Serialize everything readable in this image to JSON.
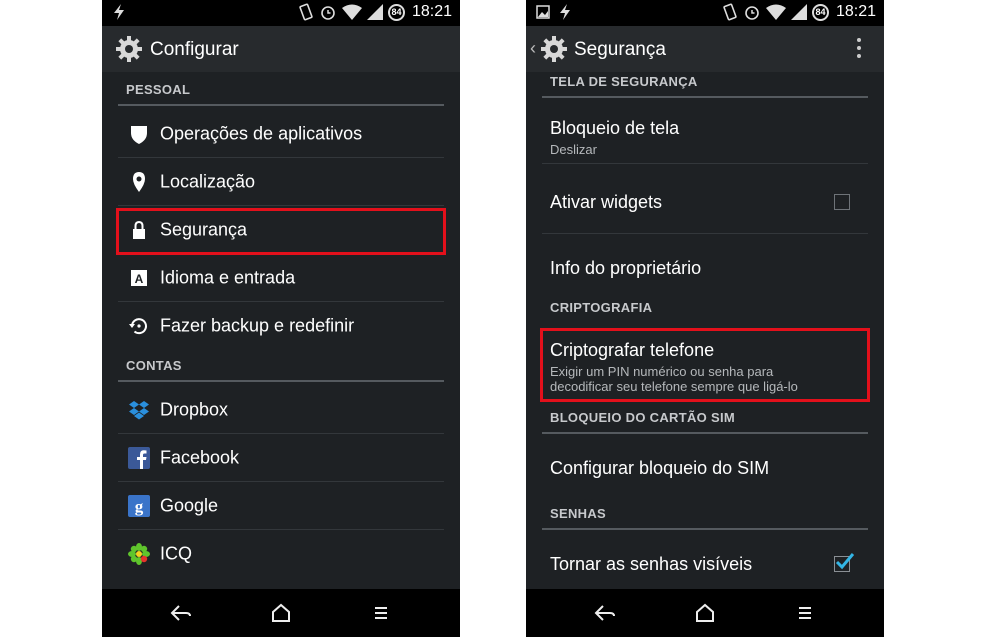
{
  "status": {
    "time": "18:21",
    "battery": "84"
  },
  "left": {
    "title": "Configurar",
    "sections": [
      {
        "header": "PESSOAL"
      },
      {
        "header": "CONTAS"
      }
    ],
    "items": [
      {
        "label": "Operações de aplicativos",
        "icon": "shield-icon"
      },
      {
        "label": "Localização",
        "icon": "location-pin-icon"
      },
      {
        "label": "Segurança",
        "icon": "lock-icon",
        "highlighted": true
      },
      {
        "label": "Idioma e entrada",
        "icon": "keyboard-a-icon"
      },
      {
        "label": "Fazer backup e redefinir",
        "icon": "backup-restore-icon"
      }
    ],
    "accounts": [
      {
        "label": "Dropbox",
        "icon": "dropbox-icon"
      },
      {
        "label": "Facebook",
        "icon": "facebook-icon"
      },
      {
        "label": "Google",
        "icon": "google-icon"
      },
      {
        "label": "ICQ",
        "icon": "icq-icon"
      }
    ]
  },
  "right": {
    "title": "Segurança",
    "sections": {
      "screen": "TELA DE SEGURANÇA",
      "crypto": "CRIPTOGRAFIA",
      "sim": "BLOQUEIO DO CARTÃO SIM",
      "passwords": "SENHAS"
    },
    "screen_lock": {
      "title": "Bloqueio de tela",
      "summary": "Deslizar"
    },
    "widgets": {
      "title": "Ativar widgets",
      "checked": false
    },
    "owner_info": {
      "title": "Info do proprietário"
    },
    "encrypt": {
      "title": "Criptografar telefone",
      "summary_line1": "Exigir um PIN numérico ou senha para",
      "summary_line2": "decodificar seu telefone sempre que ligá-lo",
      "highlighted": true
    },
    "sim_lock": {
      "title": "Configurar bloqueio do SIM"
    },
    "show_passwords": {
      "title": "Tornar as senhas visíveis",
      "checked": true
    }
  },
  "colors": {
    "background": "#1e2124",
    "actionbar": "#272a2d",
    "highlight": "#e3101b",
    "accent": "#33b5e5"
  }
}
